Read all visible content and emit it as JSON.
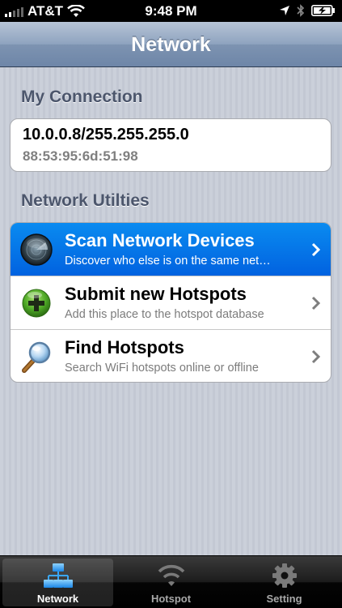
{
  "status_bar": {
    "carrier": "AT&T",
    "time": "9:48 PM"
  },
  "nav": {
    "title": "Network"
  },
  "my_connection": {
    "header": "My Connection",
    "ip": "10.0.0.8/255.255.255.0",
    "mac": "88:53:95:6d:51:98"
  },
  "utilities": {
    "header": "Network Utilties",
    "items": [
      {
        "title": "Scan Network Devices",
        "subtitle": "Discover who else is on the same net…",
        "icon": "radar-icon",
        "selected": true
      },
      {
        "title": "Submit new Hotspots",
        "subtitle": "Add this place to the hotspot database",
        "icon": "green-plus-icon",
        "selected": false
      },
      {
        "title": "Find Hotspots",
        "subtitle": "Search WiFi hotspots online or offline",
        "icon": "magnifier-icon",
        "selected": false
      }
    ]
  },
  "tabbar": {
    "tabs": [
      {
        "label": "Network",
        "icon": "network-tree-icon",
        "active": true
      },
      {
        "label": "Hotspot",
        "icon": "wifi-icon",
        "active": false
      },
      {
        "label": "Setting",
        "icon": "gear-icon",
        "active": false
      }
    ]
  },
  "colors": {
    "selection_blue": "#0162e0",
    "header_text": "#4c566c",
    "nav_bar": "#7d93b1"
  }
}
